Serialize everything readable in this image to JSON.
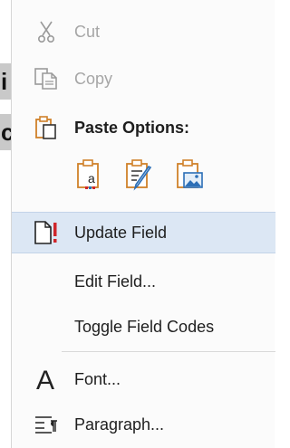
{
  "document": {
    "fragment_top": "i",
    "fragment_bottom": "c"
  },
  "menu": {
    "cut": {
      "label": "Cut",
      "icon": "scissors-icon",
      "enabled": false
    },
    "copy": {
      "label": "Copy",
      "icon": "copy-icon",
      "enabled": false
    },
    "paste_options": {
      "label": "Paste Options:",
      "icon": "clipboard-icon",
      "options": [
        {
          "name": "keep-text-only-icon"
        },
        {
          "name": "merge-formatting-icon"
        },
        {
          "name": "picture-icon"
        }
      ]
    },
    "update_field": {
      "label": "Update Field",
      "icon": "update-field-icon"
    },
    "edit_field": {
      "label": "Edit Field..."
    },
    "toggle_field_codes": {
      "label": "Toggle Field Codes"
    },
    "font": {
      "label": "Font...",
      "icon": "font-icon"
    },
    "paragraph": {
      "label": "Paragraph...",
      "icon": "paragraph-icon"
    }
  },
  "colors": {
    "hover_bg": "#dce7f4",
    "menu_bg": "#fbfbfb",
    "disabled_text": "#a6a6a6",
    "accent_orange": "#d0812a",
    "accent_red": "#d0262b",
    "accent_blue": "#2c6fb7"
  }
}
